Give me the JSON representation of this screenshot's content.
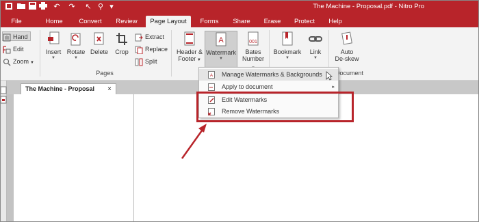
{
  "window": {
    "title": "The Machine - Proposal.pdf - Nitro Pro"
  },
  "menu_tabs": [
    {
      "label": "File"
    },
    {
      "label": "Home"
    },
    {
      "label": "Convert"
    },
    {
      "label": "Review"
    },
    {
      "label": "Page Layout"
    },
    {
      "label": "Forms"
    },
    {
      "label": "Share"
    },
    {
      "label": "Erase"
    },
    {
      "label": "Protect"
    },
    {
      "label": "Help"
    }
  ],
  "active_tab": "Page Layout",
  "tools": {
    "hand": "Hand",
    "edit": "Edit",
    "zoom": "Zoom"
  },
  "pages_group": {
    "label": "Pages",
    "buttons": {
      "insert": "Insert",
      "rotate": "Rotate",
      "delete": "Delete",
      "crop": "Crop"
    },
    "small": {
      "extract": "Extract",
      "replace": "Replace",
      "split": "Split"
    }
  },
  "layout_buttons": {
    "header_footer": [
      "Header &",
      "Footer"
    ],
    "watermark": "Watermark",
    "bates": [
      "Bates",
      "Number"
    ],
    "bookmark": "Bookmark",
    "link": "Link",
    "auto_deskew": [
      "Auto",
      "De-skew"
    ],
    "document_group_label": "Document"
  },
  "document_tab": {
    "title": "The Machine - Proposal",
    "close": "×"
  },
  "watermark_menu": {
    "items": [
      {
        "label": "Manage Watermarks & Backgrounds"
      },
      {
        "label": "Apply to document",
        "submenu": "▸"
      },
      {
        "label": "Edit Watermarks"
      },
      {
        "label": "Remove Watermarks"
      }
    ]
  },
  "colors": {
    "brand": "#b8242a",
    "ribbon_bg": "#f3f3f3",
    "annotation": "#b8242a"
  }
}
